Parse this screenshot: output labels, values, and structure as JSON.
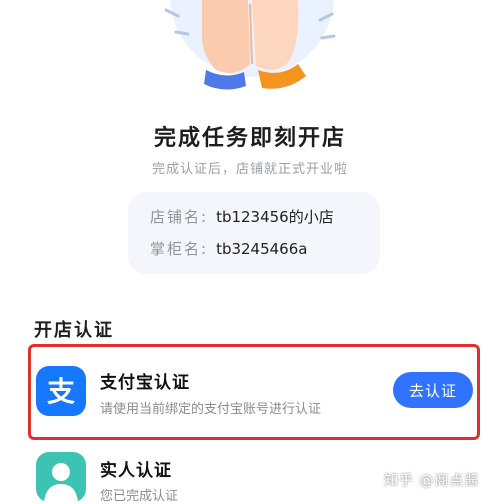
{
  "task": {
    "title": "完成任务即刻开店",
    "subtitle": "完成认证后，店铺就正式开业啦"
  },
  "shop_info": {
    "shop_name_label": "店铺名:",
    "shop_name_value": "tb123456的小店",
    "owner_label": "掌柜名:",
    "owner_value": "tb3245466a"
  },
  "section": {
    "title": "开店认证"
  },
  "verifications": [
    {
      "icon": "alipay-icon",
      "icon_glyph": "支",
      "title": "支付宝认证",
      "description": "请使用当前绑定的支付宝账号进行认证",
      "action": "去认证"
    },
    {
      "icon": "person-icon",
      "title": "实人认证",
      "description": "您已完成认证"
    }
  ],
  "watermark": "知乎 @商点酱",
  "colors": {
    "accent": "#2f73ff",
    "alipay": "#1677ff",
    "highlight": "#e0302a",
    "person_icon": "#3cc3b4"
  }
}
